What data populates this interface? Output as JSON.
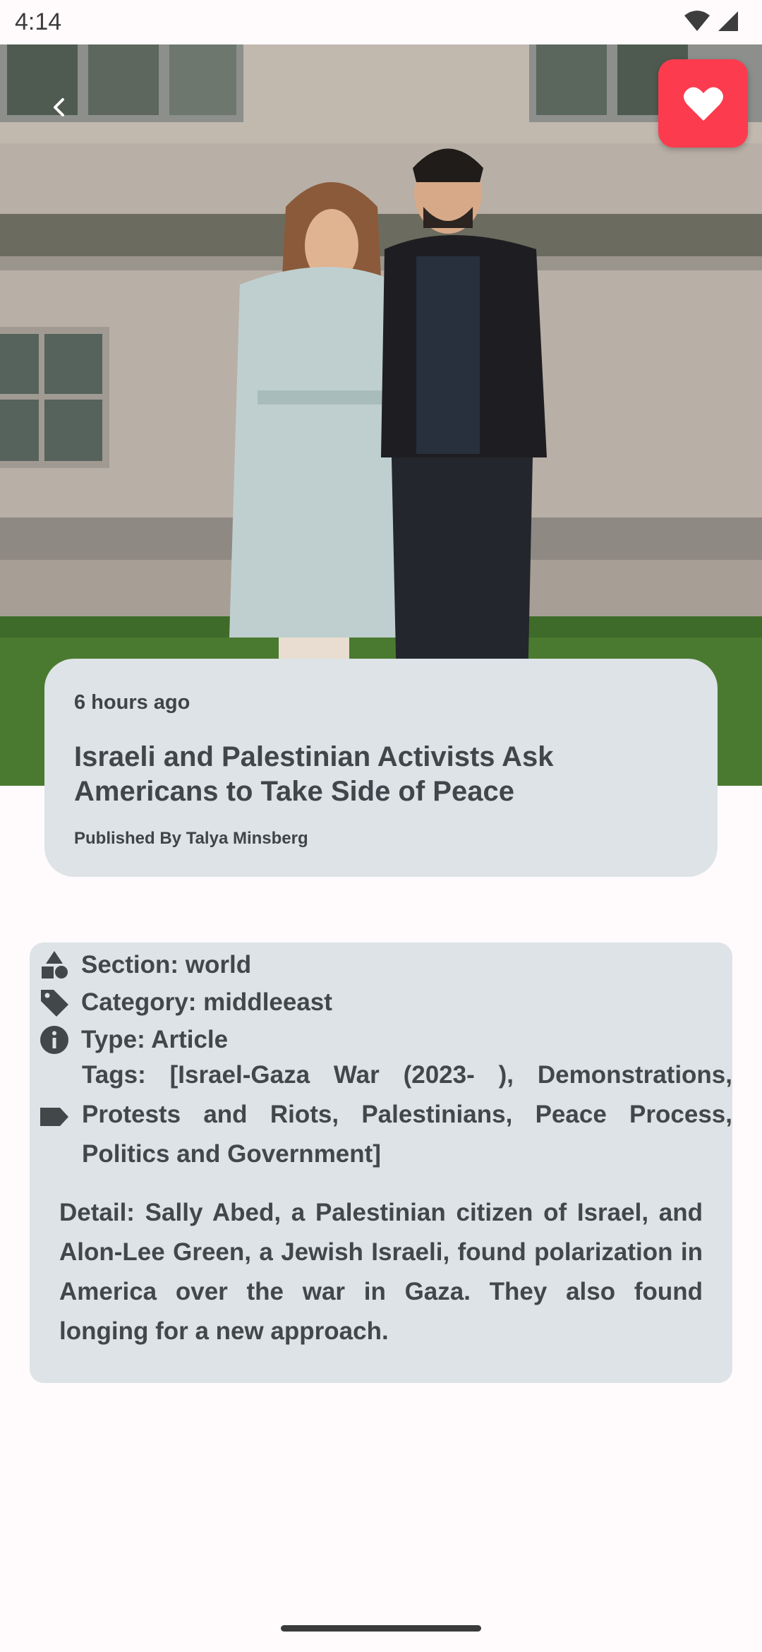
{
  "status_bar": {
    "time": "4:14"
  },
  "article": {
    "time_ago": "6 hours ago",
    "title": "Israeli and Palestinian Activists Ask Americans to Take Side of Peace",
    "byline": "Published By Talya Minsberg",
    "section": "Section: world",
    "category": "Category: middleeast",
    "type": "Type: Article",
    "tags": "Tags: [Israel-Gaza War (2023- ), Demonstrations, Protests and Riots, Palestinians, Peace Process, Politics and Government]",
    "detail": "Detail: Sally Abed, a Palestinian citizen of Israel, and Alon-Lee Green, a Jewish Israeli, found polarization in America over the war in Gaza. They also found longing for a new approach."
  },
  "icons": {
    "back": "chevron-left-icon",
    "favorite": "heart-icon",
    "section": "shapes-icon",
    "category": "tag-icon",
    "type": "info-icon",
    "tags": "label-icon",
    "wifi": "wifi-icon",
    "signal": "cell-signal-icon"
  },
  "colors": {
    "favorite_bg": "#fc3b4f",
    "card_bg": "#dde3e6",
    "page_bg": "#fffbfd"
  }
}
